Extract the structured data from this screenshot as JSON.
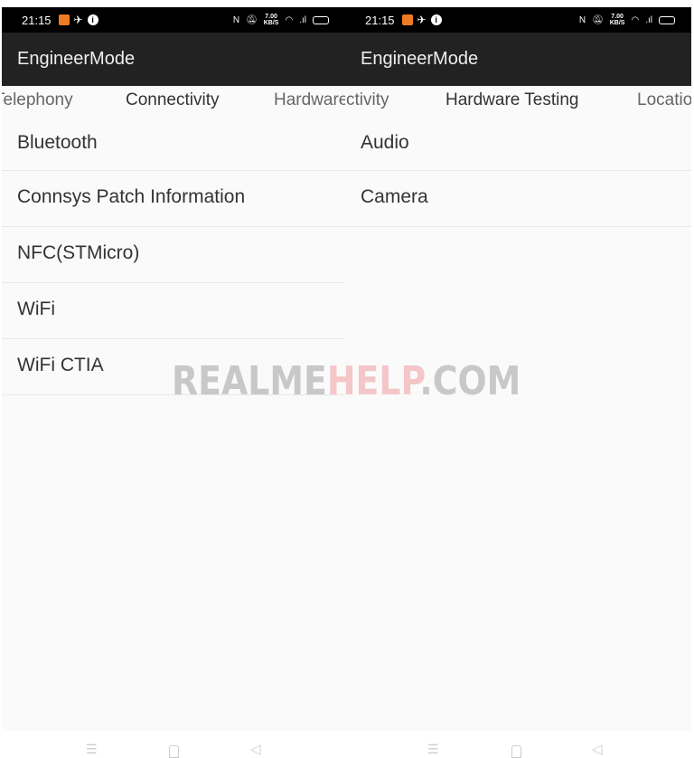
{
  "screens": [
    {
      "status": {
        "time": "21:15",
        "speed": "7.00",
        "speed_unit": "KB/S"
      },
      "app_title": "EngineerMode",
      "tabs": [
        "Telephony",
        "Connectivity",
        "Hardware Testing"
      ],
      "active_tab": "Connectivity",
      "items": [
        "Bluetooth",
        "Connsys Patch Information",
        "NFC(STMicro)",
        "WiFi",
        "WiFi CTIA"
      ]
    },
    {
      "status": {
        "time": "21:15",
        "speed": "7.00",
        "speed_unit": "KB/S"
      },
      "app_title": "EngineerMode",
      "tabs": [
        "Connectivity",
        "Hardware Testing",
        "Location"
      ],
      "active_tab": "Hardware Testing",
      "items": [
        "Audio",
        "Camera"
      ]
    }
  ],
  "watermark": {
    "part1": "REALME",
    "part2": "HELP",
    "part3": ".COM",
    "colors": {
      "gray": "#c8c8c8",
      "pink": "#f4c6c8"
    }
  },
  "icons": [
    "notification-icon",
    "rocket-icon",
    "info-icon",
    "nfc-icon",
    "mute-icon",
    "wifi-icon",
    "signal-icon",
    "battery-icon",
    "menu-icon",
    "home-icon",
    "back-icon"
  ]
}
